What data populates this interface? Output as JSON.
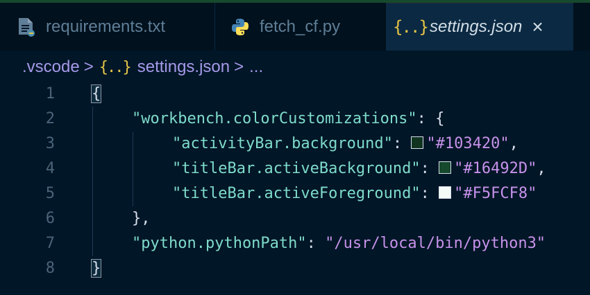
{
  "tabs": [
    {
      "label": "requirements.txt",
      "icon": "text-file-icon",
      "active": false
    },
    {
      "label": "fetch_cf.py",
      "icon": "python-icon",
      "active": false
    },
    {
      "label": "settings.json",
      "icon": "json-brace-icon",
      "active": true
    }
  ],
  "tab_icons": {
    "json_brace": "{..}",
    "close": "×"
  },
  "breadcrumb": {
    "folder": ".vscode",
    "file": "settings.json",
    "more": "...",
    "separator": ">"
  },
  "editor": {
    "line_numbers": [
      "1",
      "2",
      "3",
      "4",
      "5",
      "6",
      "7",
      "8"
    ],
    "lines": {
      "l1": {
        "open": "{"
      },
      "l2": {
        "key": "\"workbench.colorCustomizations\"",
        "sep": ": {"
      },
      "l3": {
        "key": "\"activityBar.background\"",
        "colon": ": ",
        "value": "\"#103420\"",
        "end": ",",
        "swatch": "#103420"
      },
      "l4": {
        "key": "\"titleBar.activeBackground\"",
        "colon": ": ",
        "value": "\"#16492D\"",
        "end": ",",
        "swatch": "#16492D"
      },
      "l5": {
        "key": "\"titleBar.activeForeground\"",
        "colon": ": ",
        "value": "\"#F5FCF8\"",
        "end": "",
        "swatch": "#F5FCF8"
      },
      "l6": {
        "close": "},"
      },
      "l7": {
        "key": "\"python.pythonPath\"",
        "colon": ": ",
        "value": "\"/usr/local/bin/python3\""
      },
      "l8": {
        "close": "}"
      }
    }
  },
  "colors": {
    "editor_bg": "#011627",
    "tab_bar_bg": "#01111d",
    "title_accent": "#16492d",
    "key": "#7fdbca",
    "string": "#c792ea"
  }
}
